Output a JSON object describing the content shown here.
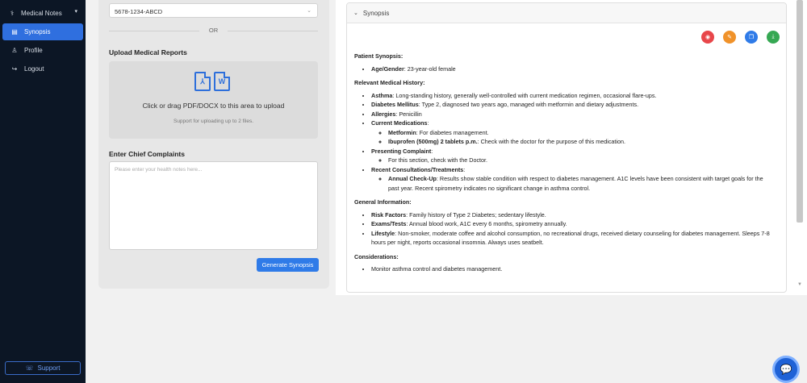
{
  "sidebar": {
    "header": {
      "label": "Medical Notes",
      "icon": "medical-notes-icon"
    },
    "items": [
      {
        "label": "Synopsis",
        "icon": "clipboard-icon",
        "active": true
      },
      {
        "label": "Profile",
        "icon": "user-icon",
        "active": false
      },
      {
        "label": "Logout",
        "icon": "logout-icon",
        "active": false
      }
    ],
    "support_label": "Support"
  },
  "left": {
    "patient_id_value": "5678-1234-ABCD",
    "or_label": "OR",
    "upload_title": "Upload Medical Reports",
    "upload_main": "Click or drag PDF/DOCX to this area to upload",
    "upload_sub": "Support for uploading up to 2 files.",
    "complaints_title": "Enter Chief Complaints",
    "complaints_placeholder": "Please enter your health notes here...",
    "generate_label": "Generate Synopsis"
  },
  "synopsis": {
    "header": "Synopsis",
    "actions": [
      {
        "icon": "hide-icon",
        "color": "#e8464a"
      },
      {
        "icon": "edit-icon",
        "color": "#f0922a"
      },
      {
        "icon": "copy-icon",
        "color": "#2f7be8"
      },
      {
        "icon": "download-icon",
        "color": "#36a853"
      }
    ],
    "patient_title": "Patient Synopsis:",
    "age_label": "Age/Gender",
    "age_value": ": 23-year-old female",
    "history_title": "Relevant Medical History:",
    "asthma_label": "Asthma",
    "asthma_value": ": Long-standing history, generally well-controlled with current medication regimen, occasional flare-ups.",
    "diabetes_label": "Diabetes Mellitus",
    "diabetes_value": ": Type 2, diagnosed two years ago, managed with metformin and dietary adjustments.",
    "allergies_label": "Allergies",
    "allergies_value": ": Penicillin",
    "meds_label": "Current Medications",
    "meds_colon": ":",
    "metformin_label": "Metformin",
    "metformin_value": ": For diabetes management.",
    "ibuprofen_label": "Ibuprofen (500mg) 2 tablets p.m.",
    "ibuprofen_value": ": Check with the doctor for the purpose of this medication.",
    "presenting_label": "Presenting Complaint",
    "presenting_colon": ":",
    "presenting_value": "For this section, check with the Doctor.",
    "recent_label": "Recent Consultations/Treatments",
    "recent_colon": ":",
    "checkup_label": "Annual Check-Up",
    "checkup_value": ": Results show stable condition with respect to diabetes management. A1C levels have been consistent with target goals for the past year. Recent spirometry indicates no significant change in asthma control.",
    "general_title": "General Information:",
    "risk_label": "Risk Factors",
    "risk_value": ": Family history of Type 2 Diabetes; sedentary lifestyle.",
    "exams_label": "Exams/Tests",
    "exams_value": ": Annual blood work, A1C every 6 months, spirometry annually.",
    "lifestyle_label": "Lifestyle",
    "lifestyle_value": ": Non-smoker, moderate coffee and alcohol consumption, no recreational drugs, received dietary counseling for diabetes management. Sleeps 7-8 hours per night, reports occasional insomnia. Always uses seatbelt.",
    "considerations_title": "Considerations:",
    "consider_1": "Monitor asthma control and diabetes management."
  },
  "colors": {
    "sidebar_bg": "#0c1625",
    "accent": "#2f6fdf"
  }
}
